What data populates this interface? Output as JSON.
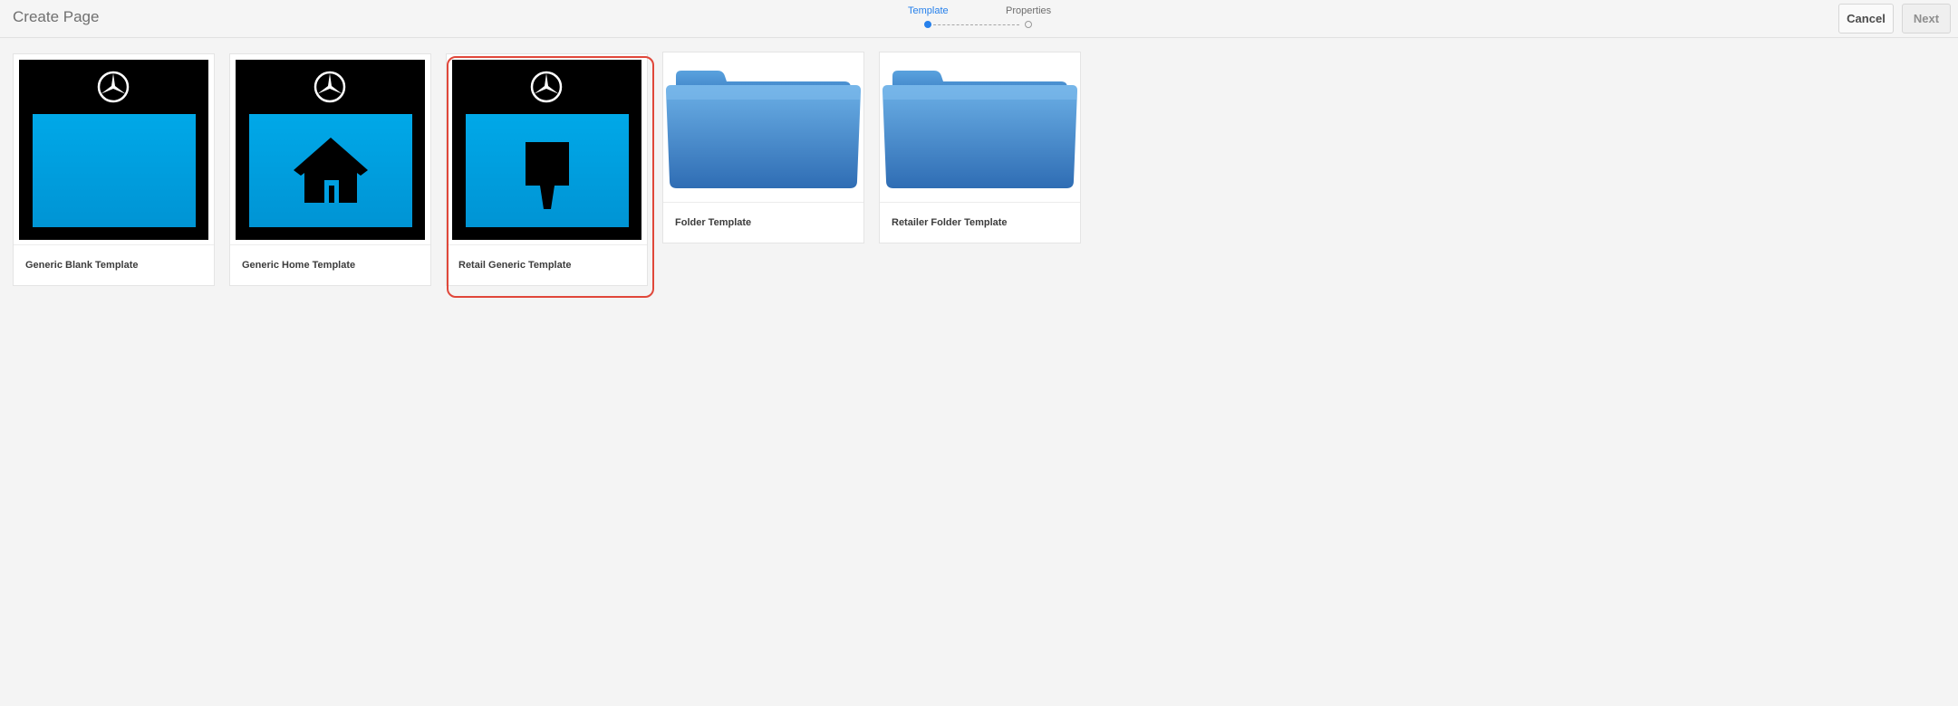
{
  "header": {
    "title": "Create Page",
    "steps": [
      {
        "label": "Template",
        "active": true
      },
      {
        "label": "Properties",
        "active": false
      }
    ],
    "cancel_label": "Cancel",
    "next_label": "Next"
  },
  "templates": [
    {
      "title": "Generic Blank Template",
      "thumbnail": "blank-page-icon",
      "selected": false
    },
    {
      "title": "Generic Home Template",
      "thumbnail": "home-icon",
      "selected": false
    },
    {
      "title": "Retail Generic Template",
      "thumbnail": "retail-pin-icon",
      "selected": true
    },
    {
      "title": "Folder Template",
      "thumbnail": "folder-icon",
      "selected": false
    },
    {
      "title": "Retailer Folder Template",
      "thumbnail": "folder-icon",
      "selected": false
    }
  ],
  "colors": {
    "accent": "#2680eb",
    "selection": "#e0473a",
    "thumbnail_blue": "#00a8e8",
    "folder_blue": "#3f88cf"
  }
}
